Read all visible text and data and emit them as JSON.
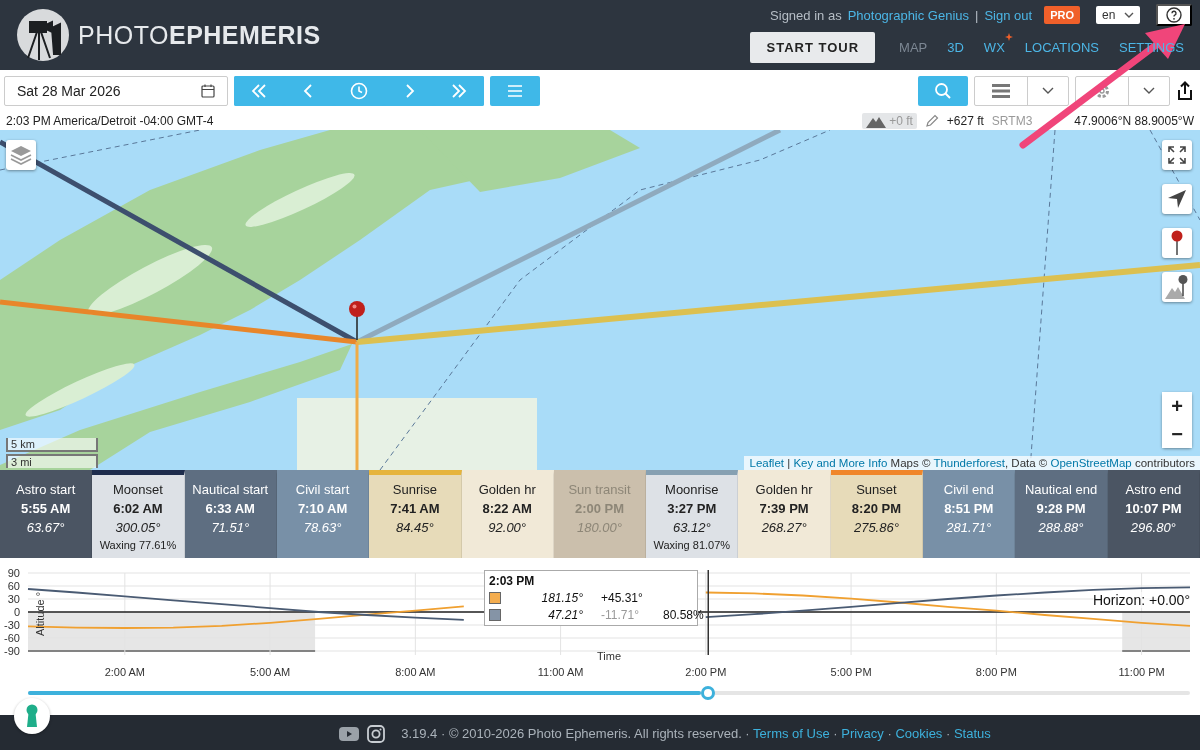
{
  "header": {
    "logo": {
      "light": "PHOTO",
      "bold": "EPHEMERIS"
    },
    "signed_in_prefix": "Signed in as",
    "user": "Photographic Genius",
    "separator": "|",
    "sign_out": "Sign out",
    "badge": "PRO",
    "language": "en",
    "start_tour": "START TOUR",
    "nav": [
      {
        "label": "MAP",
        "selected": true,
        "badge": false
      },
      {
        "label": "3D",
        "selected": false,
        "badge": false
      },
      {
        "label": "WX",
        "selected": false,
        "badge": true
      },
      {
        "label": "LOCATIONS",
        "selected": false,
        "badge": false
      },
      {
        "label": "SETTINGS",
        "selected": false,
        "badge": false
      }
    ]
  },
  "toolbar": {
    "date": "Sat 28 Mar 2026",
    "timezone": "2:03 PM America/Detroit -04:00 GMT-4",
    "elevation_offset": "+0 ft",
    "elevation": "+627 ft",
    "elevation_source": "SRTM3",
    "coordinates": "47.9006°N 88.9005°W"
  },
  "map": {
    "scale": [
      "5 km",
      "3 mi"
    ],
    "zoom_in": "+",
    "zoom_out": "−",
    "attribution": [
      {
        "text": "Leaflet",
        "link": true
      },
      {
        "text": " | ",
        "link": false
      },
      {
        "text": "Key and More Info",
        "link": true
      },
      {
        "text": " Maps © ",
        "link": false
      },
      {
        "text": "Thunderforest",
        "link": true
      },
      {
        "text": ", Data © ",
        "link": false
      },
      {
        "text": "OpenStreetMap",
        "link": true
      },
      {
        "text": " contributors",
        "link": false
      }
    ]
  },
  "events": [
    {
      "label": "Astro start",
      "time": "5:55 AM",
      "angle": "63.67°",
      "color": "#4b5563",
      "kind": "twilight",
      "dimmed": false
    },
    {
      "label": "Moonset",
      "time": "6:02 AM",
      "angle": "300.05°",
      "note": "Waxing 77.61%",
      "color": "#dde1e6",
      "kind": "moonset",
      "dimmed": false
    },
    {
      "label": "Nautical start",
      "time": "6:33 AM",
      "angle": "71.51°",
      "color": "#5e6e81",
      "kind": "twilight",
      "dimmed": false
    },
    {
      "label": "Civil start",
      "time": "7:10 AM",
      "angle": "78.63°",
      "color": "#7890a7",
      "kind": "twilight",
      "dimmed": false
    },
    {
      "label": "Sunrise",
      "time": "7:41 AM",
      "angle": "84.45°",
      "color": "#e7dbb9",
      "kind": "sunrise",
      "dimmed": false
    },
    {
      "label": "Golden hr",
      "time": "8:22 AM",
      "angle": "92.00°",
      "color": "#f1e9d7",
      "kind": "twilight",
      "dimmed": false
    },
    {
      "label": "Sun transit",
      "time": "2:00 PM",
      "angle": "180.00°",
      "color": "#cbbfac",
      "kind": "twilight",
      "dimmed": true
    },
    {
      "label": "Moonrise",
      "time": "3:27 PM",
      "angle": "63.12°",
      "note": "Waxing 81.07%",
      "color": "#dde1e6",
      "kind": "moonrise",
      "dimmed": false
    },
    {
      "label": "Golden hr",
      "time": "7:39 PM",
      "angle": "268.27°",
      "color": "#f1e9d7",
      "kind": "twilight",
      "dimmed": false
    },
    {
      "label": "Sunset",
      "time": "8:20 PM",
      "angle": "275.86°",
      "color": "#e7dbb9",
      "kind": "sunset",
      "dimmed": false
    },
    {
      "label": "Civil end",
      "time": "8:51 PM",
      "angle": "281.71°",
      "color": "#7890a7",
      "kind": "twilight",
      "dimmed": false
    },
    {
      "label": "Nautical end",
      "time": "9:28 PM",
      "angle": "288.88°",
      "color": "#5e6e81",
      "kind": "twilight",
      "dimmed": false
    },
    {
      "label": "Astro end",
      "time": "10:07 PM",
      "angle": "296.80°",
      "color": "#4b5563",
      "kind": "twilight",
      "dimmed": false
    }
  ],
  "chart": {
    "horizon": "Horizon: +0.00°",
    "tooltip": {
      "time": "2:03 PM",
      "rows": [
        {
          "color": "#f4ad4f",
          "azimuth": "181.15°",
          "altitude": "+45.31°",
          "dimmed": false
        },
        {
          "color": "#8594a6",
          "azimuth": "47.21°",
          "altitude": "-11.71°",
          "dimmed": true,
          "illumination": "80.58%"
        }
      ]
    },
    "chart_data": {
      "type": "line",
      "grid": true,
      "xlabel": "Time",
      "ylabel": "Altitude °",
      "x": [
        0,
        1,
        2,
        3,
        4,
        5,
        6,
        7,
        8,
        9,
        14,
        15,
        16,
        17,
        18,
        19,
        20,
        21,
        22,
        23,
        24
      ],
      "bands": [
        {
          "axis": "x",
          "from": 0,
          "to": 5.93
        },
        {
          "axis": "x",
          "from": 22.6,
          "to": 24
        }
      ],
      "ref_lines": [
        {
          "axis": "x",
          "value": 14.05
        }
      ],
      "xlim": [
        0,
        24
      ],
      "ylim": [
        -90,
        90
      ],
      "yticks": [
        90,
        60,
        30,
        0,
        -30,
        -60,
        -90
      ],
      "xticks": [
        {
          "value": 2,
          "label": "2:00 AM"
        },
        {
          "value": 5,
          "label": "5:00 AM"
        },
        {
          "value": 8,
          "label": "8:00 AM"
        },
        {
          "value": 11,
          "label": "11:00 AM"
        },
        {
          "value": 14,
          "label": "2:00 PM"
        },
        {
          "value": 17,
          "label": "5:00 PM"
        },
        {
          "value": 20,
          "label": "8:00 PM"
        },
        {
          "value": 23,
          "label": "11:00 PM"
        }
      ],
      "series": [
        {
          "color": "#f0a030",
          "values": [
            -33,
            -36,
            -37,
            -36,
            -32,
            -25,
            -16,
            -6,
            3,
            13,
            45,
            43,
            38,
            31,
            22,
            12,
            3,
            -7,
            -16,
            -25,
            -32
          ]
        },
        {
          "color": "#4a5b73",
          "values": [
            53,
            45,
            36,
            27,
            18,
            9,
            0,
            -7,
            -13,
            -18,
            -12,
            -5,
            3,
            12,
            21,
            30,
            38,
            45,
            51,
            55,
            57
          ]
        }
      ]
    }
  },
  "timeline": {
    "level": 0.585
  },
  "footer": {
    "parts": [
      {
        "text": "3.19.4 · © 2010-2026 Photo Ephemeris. All rights reserved. · ",
        "link": false
      },
      {
        "text": "Terms of Use",
        "link": true
      },
      {
        "text": " · ",
        "link": false
      },
      {
        "text": "Privacy",
        "link": true
      },
      {
        "text": " · ",
        "link": false
      },
      {
        "text": "Cookies",
        "link": true
      },
      {
        "text": " · ",
        "link": false
      },
      {
        "text": "Status",
        "link": true
      }
    ]
  }
}
